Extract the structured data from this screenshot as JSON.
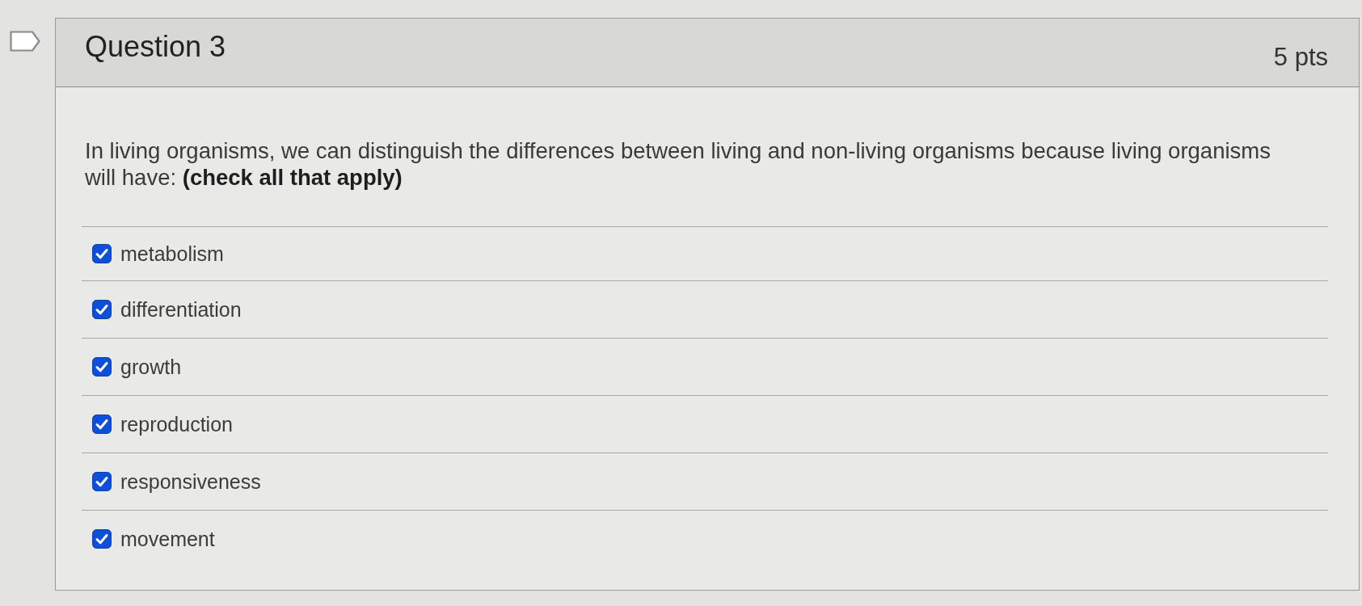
{
  "question": {
    "flagged": false,
    "title": "Question 3",
    "points": "5 pts",
    "text": "In living organisms, we can distinguish the differences between living and non-living organisms because living organisms will have: **(check all that apply)**",
    "answers": [
      {
        "label": "metabolism",
        "checked": true
      },
      {
        "label": "differentiation",
        "checked": true
      },
      {
        "label": "growth",
        "checked": true
      },
      {
        "label": "reproduction",
        "checked": true
      },
      {
        "label": "responsiveness",
        "checked": true
      },
      {
        "label": "movement",
        "checked": true
      }
    ]
  }
}
